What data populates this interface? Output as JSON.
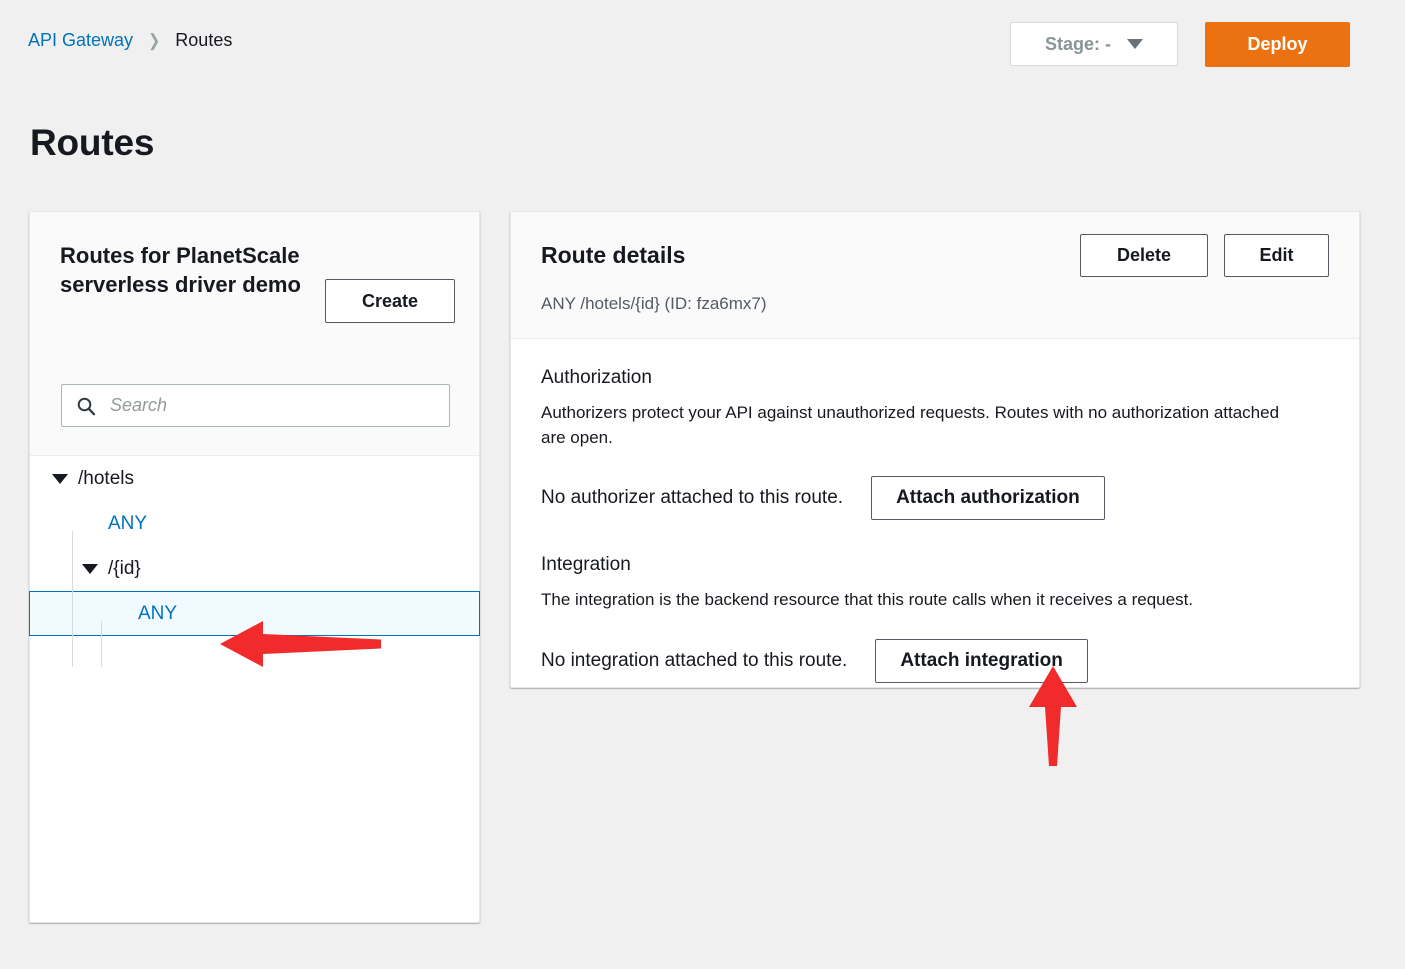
{
  "breadcrumb": {
    "root": "API Gateway",
    "separator": "❯",
    "current": "Routes"
  },
  "header": {
    "stage_label": "Stage: -",
    "deploy_label": "Deploy"
  },
  "page": {
    "title": "Routes"
  },
  "routes_panel": {
    "title": "Routes for PlanetScale serverless driver demo",
    "create_label": "Create",
    "search_placeholder": "Search",
    "search_value": "",
    "tree": [
      {
        "label": "/hotels",
        "type": "path",
        "depth": 0,
        "expanded": true,
        "selected": false
      },
      {
        "label": "ANY",
        "type": "method",
        "depth": 1,
        "expanded": false,
        "selected": false
      },
      {
        "label": "/{id}",
        "type": "path",
        "depth": 1,
        "expanded": true,
        "selected": false
      },
      {
        "label": "ANY",
        "type": "method",
        "depth": 2,
        "expanded": false,
        "selected": true
      }
    ]
  },
  "route_details": {
    "title": "Route details",
    "subtitle": "ANY /hotels/{id} (ID: fza6mx7)",
    "delete_label": "Delete",
    "edit_label": "Edit",
    "authorization": {
      "heading": "Authorization",
      "description": "Authorizers protect your API against unauthorized requests. Routes with no authorization attached are open.",
      "status": "No authorizer attached to this route.",
      "button_label": "Attach authorization"
    },
    "integration": {
      "heading": "Integration",
      "description": "The integration is the backend resource that this route calls when it receives a request.",
      "status": "No integration attached to this route.",
      "button_label": "Attach integration"
    }
  },
  "annotations": {
    "arrow_color": "#f12b2b",
    "arrows": [
      {
        "name": "arrow-pointing-selected-route",
        "direction": "left"
      },
      {
        "name": "arrow-pointing-attach-integration",
        "direction": "up"
      }
    ]
  },
  "colors": {
    "link": "#0073bb",
    "deploy": "#ec7211",
    "selected_row_bg": "#f1faff",
    "page_bg": "#f0f0f1"
  }
}
